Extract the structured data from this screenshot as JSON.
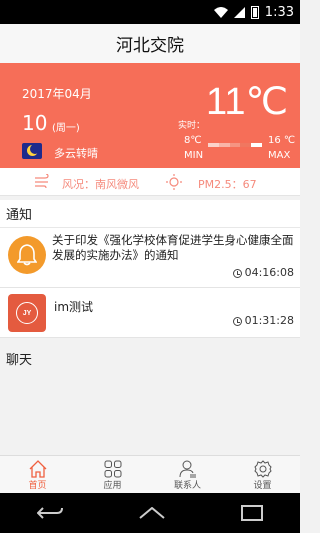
{
  "status_bar": {
    "time": "1:33"
  },
  "header": {
    "title": "河北交院"
  },
  "weather": {
    "date": "2017年04月",
    "day": "10",
    "weekday": "(周一)",
    "condition": "多云转晴",
    "now_label": "实时：",
    "temperature": "11℃",
    "min_temp": "8℃",
    "max_temp": "16 ℃",
    "min_label": "MIN",
    "max_label": "MAX",
    "wind": "风况：南风微风",
    "pm": "PM2.5：67"
  },
  "notice_section": {
    "title": "通知"
  },
  "notices": [
    {
      "text": "关于印发《强化学校体育促进学生身心健康全面发展的实施办法》的通知",
      "time": "04:16:08",
      "icon": "bell-icon"
    },
    {
      "text": "im测试",
      "time": "01:31:28",
      "icon": "jy-logo",
      "logo_text": "JY"
    }
  ],
  "chat_section": {
    "title": "聊天"
  },
  "tabs": [
    {
      "label": "首页",
      "icon": "home-icon",
      "active": true
    },
    {
      "label": "应用",
      "icon": "apps-icon",
      "active": false
    },
    {
      "label": "联系人",
      "icon": "contacts-icon",
      "active": false
    },
    {
      "label": "设置",
      "icon": "settings-icon",
      "active": false
    }
  ],
  "colors": {
    "accent": "#f66e58",
    "bell": "#f39a2b",
    "active_tab": "#f0603f"
  }
}
